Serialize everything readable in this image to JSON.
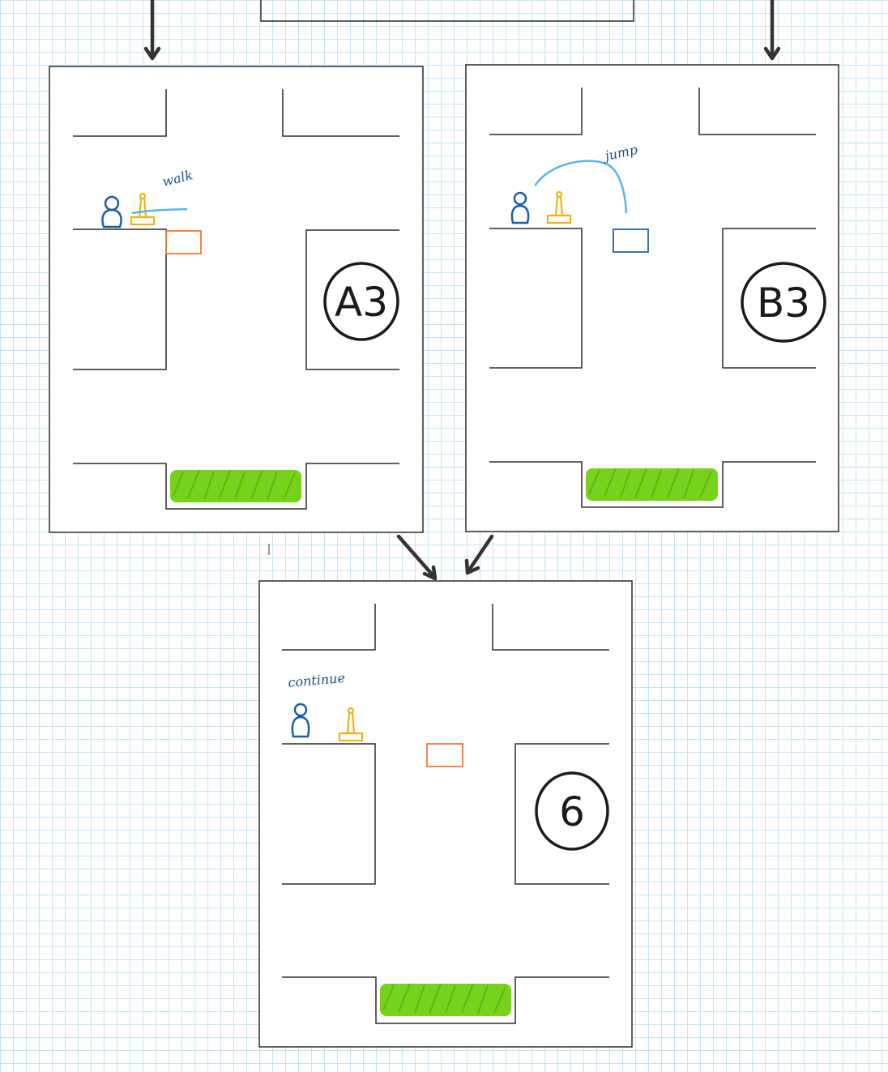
{
  "panels": [
    {
      "id": "A3",
      "label": "A3",
      "action_note": "walk",
      "target": "orange-box"
    },
    {
      "id": "B3",
      "label": "B3",
      "action_note": "jump",
      "target": "blue-box"
    },
    {
      "id": "6",
      "label": "6",
      "action_note": "continue",
      "target": "orange-box"
    }
  ],
  "colors": {
    "grid": "#c6e4f2",
    "outline": "#2b2b2b",
    "player": "#1d5da8",
    "statue": "#f0b21a",
    "path": "#56b8e6",
    "orange_box": "#ee7a3b",
    "blue_box": "#2566a8",
    "grass": "#76d21a"
  },
  "icons": [
    "player-figure-icon",
    "statue-icon",
    "grass-icon",
    "arrow-down-icon"
  ]
}
